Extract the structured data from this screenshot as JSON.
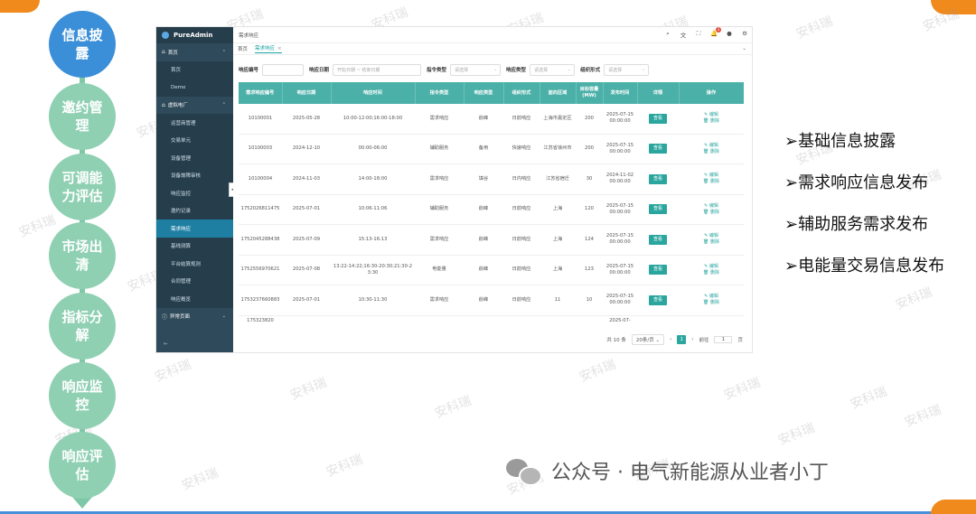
{
  "steps": [
    "信息披露",
    "邀约管理",
    "可调能力评估",
    "市场出清",
    "指标分解",
    "响应监控",
    "响应评估"
  ],
  "active_step": 0,
  "app": {
    "brand": "PureAdmin",
    "menu": [
      {
        "type": "group",
        "label": "首页",
        "icon": "home-icon",
        "expanded": true
      },
      {
        "type": "sub",
        "label": "首页"
      },
      {
        "type": "sub",
        "label": "Demo"
      },
      {
        "type": "group",
        "label": "虚拟电厂",
        "icon": "home-icon",
        "expanded": true
      },
      {
        "type": "sub",
        "label": "运营商管理"
      },
      {
        "type": "sub",
        "label": "交易单元"
      },
      {
        "type": "sub",
        "label": "设备管理"
      },
      {
        "type": "sub",
        "label": "设备故障审核"
      },
      {
        "type": "sub",
        "label": "响应监控"
      },
      {
        "type": "sub",
        "label": "邀约记录"
      },
      {
        "type": "sub",
        "label": "需求响应",
        "active": true
      },
      {
        "type": "sub",
        "label": "基线测算"
      },
      {
        "type": "sub",
        "label": "平台结算规则"
      },
      {
        "type": "sub",
        "label": "合同管理"
      },
      {
        "type": "sub",
        "label": "响应概览"
      },
      {
        "type": "group",
        "label": "异常页面",
        "icon": "info-icon",
        "expanded": false
      }
    ],
    "topbar_title": "需求响应",
    "tabs": [
      {
        "label": "首页"
      },
      {
        "label": "需求响应",
        "active": true,
        "close": "×"
      }
    ],
    "notif_count": "3",
    "filters": [
      {
        "label": "响应编号",
        "placeholder": ""
      },
      {
        "label": "响应日期",
        "placeholder": "开始日期  ~  结束日期"
      },
      {
        "label": "指令类型",
        "placeholder": "请选择"
      },
      {
        "label": "响应类型",
        "placeholder": "请选择"
      },
      {
        "label": "组织形式",
        "placeholder": "请选择"
      }
    ],
    "columns": [
      "需求响应编号",
      "响应日期",
      "响应时间",
      "指令类型",
      "响应类型",
      "组织形式",
      "面向区域",
      "目标容量(MW)",
      "发布时间",
      "详情",
      "操作"
    ],
    "rows": [
      [
        "10100001",
        "2025-05-28",
        "10:00-12:00;16:00-18:00",
        "需求响应",
        "削峰",
        "日前响应",
        "上海市嘉定区",
        "200",
        "2025-07-15 00:00:00"
      ],
      [
        "10100003",
        "2024-12-10",
        "00:00-06:00",
        "辅助服务",
        "备用",
        "快速响应",
        "江苏省徐州市",
        "200",
        "2025-07-15 00:00:00"
      ],
      [
        "10100004",
        "2024-11-03",
        "14:00-18:00",
        "需求响应",
        "填谷",
        "日内响应",
        "江苏省宿迁",
        "30",
        "2024-11-02 00:00:00"
      ],
      [
        "1752026811475",
        "2025-07-01",
        "10:06-11:06",
        "辅助服务",
        "削峰",
        "日前响应",
        "上海",
        "120",
        "2025-07-15 00:00:00"
      ],
      [
        "1752045288438",
        "2025-07-09",
        "15:13-16:13",
        "需求响应",
        "削峰",
        "日前响应",
        "上海",
        "124",
        "2025-07-15 00:00:00"
      ],
      [
        "1752556970621",
        "2025-07-08",
        "13:22-14:22;16:30-20:30;21:30-23:30",
        "电能量",
        "削峰",
        "日前响应",
        "上海",
        "123",
        "2025-07-15 00:00:00"
      ],
      [
        "1753237660883",
        "2025-07-01",
        "10:30-11:30",
        "需求响应",
        "削峰",
        "日前响应",
        "11",
        "10",
        "2025-07-15 00:00:00"
      ],
      [
        "175323820",
        "",
        "",
        "",
        "",
        "",
        "",
        "",
        "2025-07-"
      ]
    ],
    "view_label": "查看",
    "edit_label": "✎ 编辑",
    "delete_label": "🗑 删除",
    "pager": {
      "total": "共 10 条",
      "size": "20条/页",
      "page": "1",
      "goto": "前往",
      "goto_value": "1",
      "unit": "页"
    }
  },
  "bullets": [
    "➢基础信息披露",
    "➢需求响应信息发布",
    "➢辅助服务需求发布",
    "➢电能量交易信息发布"
  ],
  "watermark": "安科瑞",
  "footer": "公众号 · 电气新能源从业者小丁",
  "colors": {
    "active_step": "#3b8fd8",
    "step": "#8fd0b3",
    "sidebar": "#2f4a5a",
    "teal": "#4bb0a8",
    "accent_orange": "#f08a1c"
  }
}
